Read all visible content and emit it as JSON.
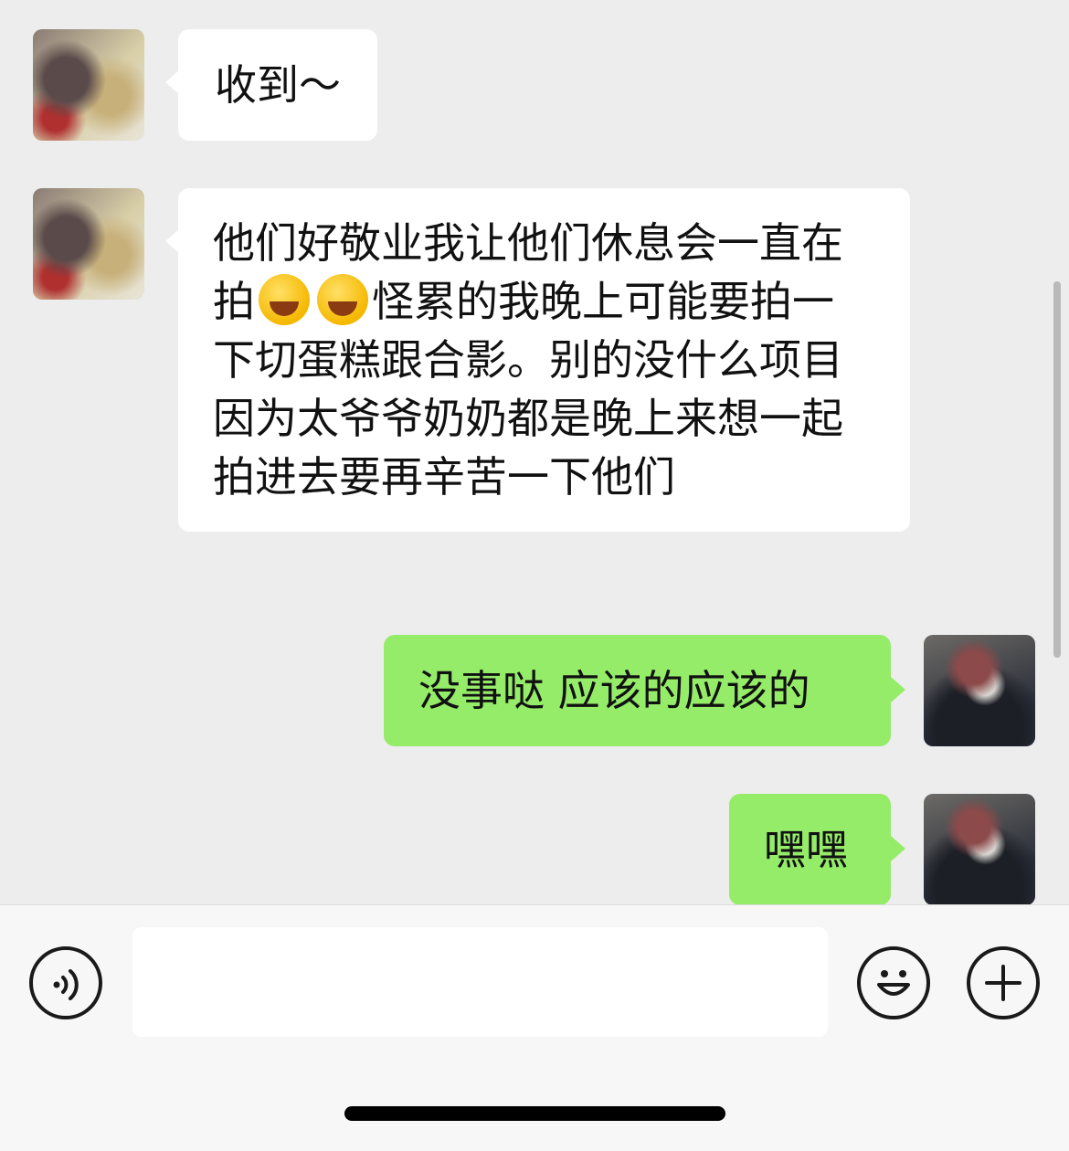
{
  "messages": [
    {
      "side": "left",
      "text": "收到～"
    },
    {
      "side": "left",
      "text_before_emoji": "他们好敬业我让他们休息会一直在拍",
      "emoji_icon": "crying-laughing-emoji-icon",
      "text_after_emoji": "怪累的我晚上可能要拍一下切蛋糕跟合影。别的没什么项目因为太爷爷奶奶都是晚上来想一起拍进去要再辛苦一下他们"
    },
    {
      "side": "right",
      "text": "没事哒 应该的应该的"
    },
    {
      "side": "right",
      "text": "嘿嘿"
    }
  ],
  "input": {
    "placeholder": ""
  },
  "icons": {
    "voice": "voice-icon",
    "emoji": "emoji-icon",
    "more": "plus-icon"
  },
  "colors": {
    "background": "#ededed",
    "bubble_left": "#ffffff",
    "bubble_right": "#95ec69",
    "footer": "#f7f7f7"
  }
}
